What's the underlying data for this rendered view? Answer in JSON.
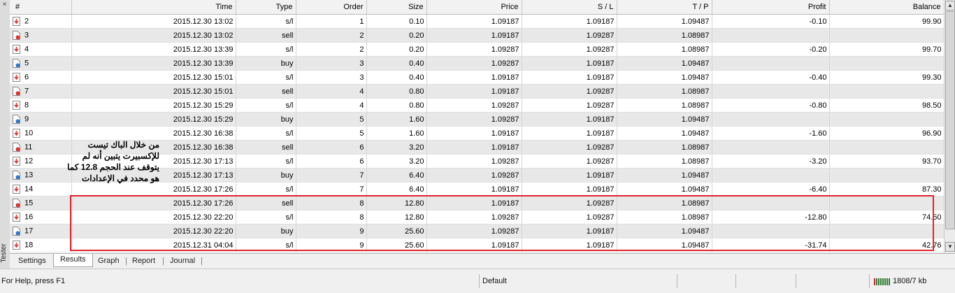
{
  "columns": [
    "#",
    "Time",
    "Type",
    "Order",
    "Size",
    "Price",
    "S / L",
    "T / P",
    "Profit",
    "Balance"
  ],
  "rows": [
    {
      "n": "2",
      "time": "2015.12.30 13:02",
      "type": "s/l",
      "order": "1",
      "size": "0.10",
      "price": "1.09187",
      "sl": "1.09187",
      "tp": "1.09487",
      "profit": "-0.10",
      "balance": "99.90",
      "icon": "close-trade-icon"
    },
    {
      "n": "3",
      "time": "2015.12.30 13:02",
      "type": "sell",
      "order": "2",
      "size": "0.20",
      "price": "1.09187",
      "sl": "1.09287",
      "tp": "1.08987",
      "profit": "",
      "balance": "",
      "icon": "sell-order-icon"
    },
    {
      "n": "4",
      "time": "2015.12.30 13:39",
      "type": "s/l",
      "order": "2",
      "size": "0.20",
      "price": "1.09287",
      "sl": "1.09287",
      "tp": "1.08987",
      "profit": "-0.20",
      "balance": "99.70",
      "icon": "close-trade-icon"
    },
    {
      "n": "5",
      "time": "2015.12.30 13:39",
      "type": "buy",
      "order": "3",
      "size": "0.40",
      "price": "1.09287",
      "sl": "1.09187",
      "tp": "1.09487",
      "profit": "",
      "balance": "",
      "icon": "buy-order-icon"
    },
    {
      "n": "6",
      "time": "2015.12.30 15:01",
      "type": "s/l",
      "order": "3",
      "size": "0.40",
      "price": "1.09187",
      "sl": "1.09187",
      "tp": "1.09487",
      "profit": "-0.40",
      "balance": "99.30",
      "icon": "close-trade-icon"
    },
    {
      "n": "7",
      "time": "2015.12.30 15:01",
      "type": "sell",
      "order": "4",
      "size": "0.80",
      "price": "1.09187",
      "sl": "1.09287",
      "tp": "1.08987",
      "profit": "",
      "balance": "",
      "icon": "sell-order-icon"
    },
    {
      "n": "8",
      "time": "2015.12.30 15:29",
      "type": "s/l",
      "order": "4",
      "size": "0.80",
      "price": "1.09287",
      "sl": "1.09287",
      "tp": "1.08987",
      "profit": "-0.80",
      "balance": "98.50",
      "icon": "close-trade-icon"
    },
    {
      "n": "9",
      "time": "2015.12.30 15:29",
      "type": "buy",
      "order": "5",
      "size": "1.60",
      "price": "1.09287",
      "sl": "1.09187",
      "tp": "1.09487",
      "profit": "",
      "balance": "",
      "icon": "buy-order-icon"
    },
    {
      "n": "10",
      "time": "2015.12.30 16:38",
      "type": "s/l",
      "order": "5",
      "size": "1.60",
      "price": "1.09187",
      "sl": "1.09187",
      "tp": "1.09487",
      "profit": "-1.60",
      "balance": "96.90",
      "icon": "close-trade-icon"
    },
    {
      "n": "11",
      "time": "2015.12.30 16:38",
      "type": "sell",
      "order": "6",
      "size": "3.20",
      "price": "1.09187",
      "sl": "1.09287",
      "tp": "1.08987",
      "profit": "",
      "balance": "",
      "icon": "sell-order-icon"
    },
    {
      "n": "12",
      "time": "2015.12.30 17:13",
      "type": "s/l",
      "order": "6",
      "size": "3.20",
      "price": "1.09287",
      "sl": "1.09287",
      "tp": "1.08987",
      "profit": "-3.20",
      "balance": "93.70",
      "icon": "close-trade-icon"
    },
    {
      "n": "13",
      "time": "2015.12.30 17:13",
      "type": "buy",
      "order": "7",
      "size": "6.40",
      "price": "1.09287",
      "sl": "1.09187",
      "tp": "1.09487",
      "profit": "",
      "balance": "",
      "icon": "buy-order-icon"
    },
    {
      "n": "14",
      "time": "2015.12.30 17:26",
      "type": "s/l",
      "order": "7",
      "size": "6.40",
      "price": "1.09187",
      "sl": "1.09187",
      "tp": "1.09487",
      "profit": "-6.40",
      "balance": "87.30",
      "icon": "close-trade-icon"
    },
    {
      "n": "15",
      "time": "2015.12.30 17:26",
      "type": "sell",
      "order": "8",
      "size": "12.80",
      "price": "1.09187",
      "sl": "1.09287",
      "tp": "1.08987",
      "profit": "",
      "balance": "",
      "icon": "sell-order-icon"
    },
    {
      "n": "16",
      "time": "2015.12.30 22:20",
      "type": "s/l",
      "order": "8",
      "size": "12.80",
      "price": "1.09287",
      "sl": "1.09287",
      "tp": "1.08987",
      "profit": "-12.80",
      "balance": "74.50",
      "icon": "close-trade-icon"
    },
    {
      "n": "17",
      "time": "2015.12.30 22:20",
      "type": "buy",
      "order": "9",
      "size": "25.60",
      "price": "1.09287",
      "sl": "1.09187",
      "tp": "1.09487",
      "profit": "",
      "balance": "",
      "icon": "buy-order-icon"
    },
    {
      "n": "18",
      "time": "2015.12.31 04:04",
      "type": "s/l",
      "order": "9",
      "size": "25.60",
      "price": "1.09187",
      "sl": "1.09187",
      "tp": "1.09487",
      "profit": "-31.74",
      "balance": "42.76",
      "icon": "close-trade-icon"
    }
  ],
  "annotation": {
    "lines": [
      "من خلال الباك تيست",
      "للإكسبيرت يتبين أنه لم",
      "يتوقف عند الحجم 12.8 كما",
      "هو محدد في الإعدادات"
    ],
    "highlight_color": "#e0242c"
  },
  "tabs": [
    "Settings",
    "Results",
    "Graph",
    "Report",
    "Journal"
  ],
  "active_tab": "Results",
  "side_label": "Tester",
  "side_close": "×",
  "statusbar": {
    "help": "For Help, press F1",
    "profile": "Default",
    "traffic": "1808/7 kb"
  },
  "colors": {
    "buy_icon": "#2f78c8",
    "sell_icon": "#d8342c",
    "close_icon": "#d8342c",
    "row_alt": "#e8e8e8"
  }
}
